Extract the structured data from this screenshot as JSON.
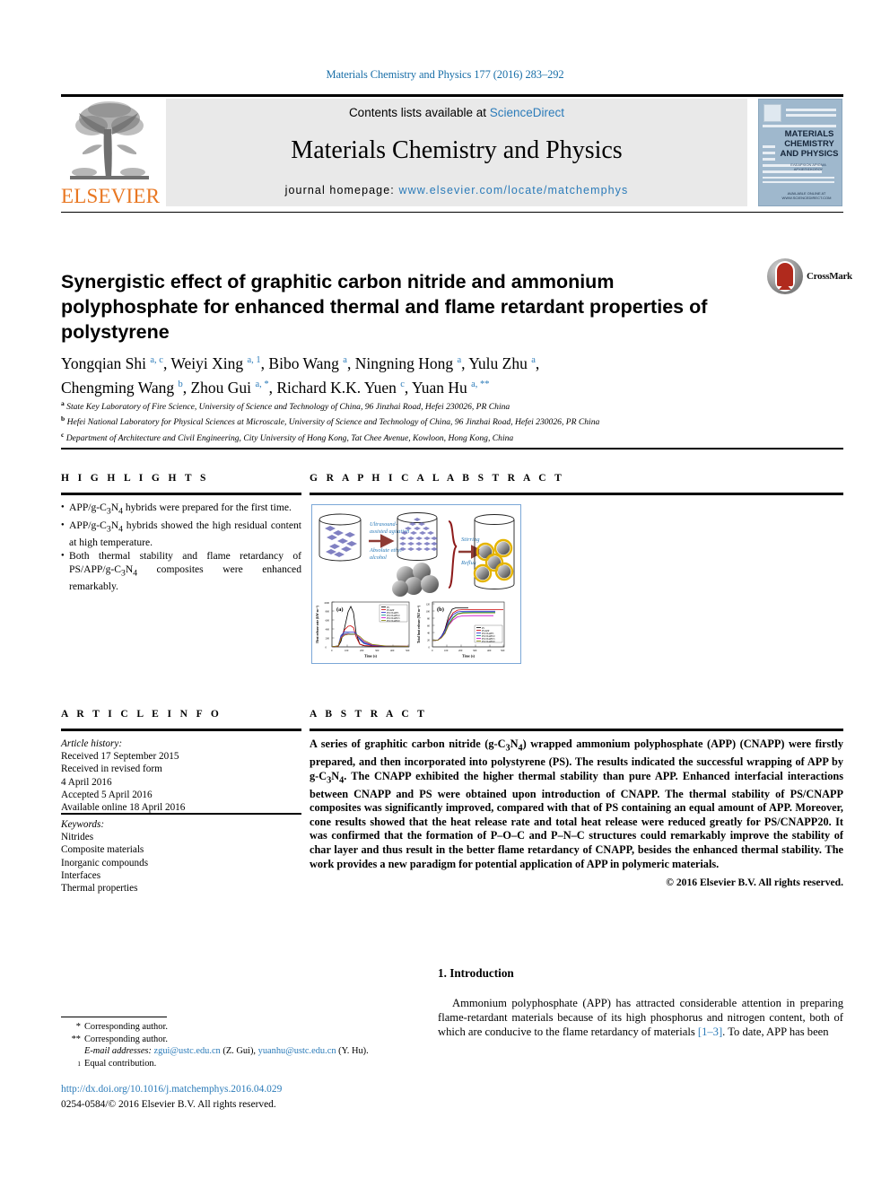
{
  "running_head": "Materials Chemistry and Physics 177 (2016) 283–292",
  "masthead": {
    "publisher_logo_text": "ELSEVIER",
    "contents_prefix": "Contents lists available at ",
    "contents_link": "ScienceDirect",
    "journal_title": "Materials Chemistry and Physics",
    "homepage_prefix": "journal homepage: ",
    "homepage_link": "www.elsevier.com/locate/matchemphys",
    "cover": {
      "title": "MATERIALS CHEMISTRY AND PHYSICS",
      "subtitle": "ΕΛΕΑΡΧΙΟΝ  ΑΡΙΘΜΑ ΑΡΧΙΕΠΙΣΚΟΠΟΥ",
      "footer": "AVAILABLE ONLINE AT WWW.SCIENCEDIRECT.COM"
    }
  },
  "article": {
    "title": "Synergistic effect of graphitic carbon nitride and ammonium polyphosphate for enhanced thermal and flame retardant properties of polystyrene",
    "crossmark_label": "CrossMark",
    "authors_line1": "Yongqian Shi <sup>a, c</sup>, Weiyi Xing <sup>a, 1</sup>, Bibo Wang <sup>a</sup>, Ningning Hong <sup>a</sup>, Yulu Zhu <sup>a</sup>,",
    "authors_line2": "Chengming Wang <sup>b</sup>, Zhou Gui <sup>a, *</sup>, Richard K.K. Yuen <sup>c</sup>, Yuan Hu <sup>a, **</sup>",
    "affiliations": [
      "<sup>a</sup> State Key Laboratory of Fire Science, University of Science and Technology of China, 96 Jinzhai Road, Hefei 230026, PR China",
      "<sup>b</sup> Hefei National Laboratory for Physical Sciences at Microscale, University of Science and Technology of China, 96 Jinzhai Road, Hefei 230026, PR China",
      "<sup>c</sup> Department of Architecture and Civil Engineering, City University of Hong Kong, Tat Chee Avenue, Kowloon, Hong Kong, China"
    ]
  },
  "highlights": {
    "heading": "H I G H L I G H T S",
    "items": [
      "APP/g-C<sub>3</sub>N<sub>4</sub> hybrids were prepared for the first time.",
      "APP/g-C<sub>3</sub>N<sub>4</sub> hybrids showed the high residual content at high temperature.",
      "Both thermal stability and flame retardancy of PS/APP/g-C<sub>3</sub>N<sub>4</sub> composites were enhanced remarkably."
    ]
  },
  "graphical_abstract": {
    "heading": "G R A P H I C A L  A B S T R A C T",
    "diagram_labels": {
      "step1": "Ultrasound-assisted agitation",
      "step2": "Absolute ethyl alcohol",
      "step3": "Stirring",
      "step4": "Reflux"
    },
    "panel_a_label": "(a)",
    "panel_b_label": "(b)"
  },
  "chart_data": [
    {
      "type": "line",
      "title": "(a)",
      "xlabel": "Time (s)",
      "ylabel": "Heat release rate (kW m⁻²)",
      "xlim": [
        0,
        500
      ],
      "ylim": [
        0,
        1000
      ],
      "xticks": [
        0,
        100,
        200,
        300,
        400,
        500
      ],
      "yticks": [
        0,
        200,
        400,
        600,
        800,
        1000
      ],
      "legend_position": "upper-right",
      "series": [
        {
          "name": "PS",
          "color": "#000000",
          "x": [
            0,
            40,
            60,
            90,
            120,
            140,
            160,
            180,
            200,
            240,
            300,
            400,
            500
          ],
          "values": [
            5,
            10,
            120,
            420,
            780,
            900,
            760,
            300,
            60,
            25,
            15,
            10,
            8
          ]
        },
        {
          "name": "PS/APP",
          "color": "#cc0000",
          "x": [
            0,
            40,
            60,
            90,
            120,
            140,
            160,
            180,
            200,
            240,
            300,
            400,
            500
          ],
          "values": [
            5,
            10,
            180,
            380,
            460,
            470,
            430,
            220,
            60,
            30,
            20,
            15,
            12
          ]
        },
        {
          "name": "PS/CNAPP5",
          "color": "#2222cc",
          "x": [
            0,
            40,
            60,
            90,
            120,
            140,
            160,
            180,
            200,
            240,
            300,
            400,
            500
          ],
          "values": [
            5,
            15,
            250,
            340,
            330,
            330,
            330,
            300,
            160,
            70,
            30,
            15,
            10
          ]
        },
        {
          "name": "PS/CNAPP10",
          "color": "#008b8b",
          "x": [
            0,
            40,
            60,
            90,
            120,
            140,
            160,
            180,
            200,
            240,
            300,
            400,
            500
          ],
          "values": [
            5,
            20,
            230,
            300,
            300,
            290,
            290,
            270,
            180,
            90,
            35,
            15,
            10
          ]
        },
        {
          "name": "PS/CNAPP15",
          "color": "#cc00cc",
          "x": [
            0,
            40,
            60,
            90,
            120,
            140,
            160,
            180,
            200,
            240,
            300,
            400,
            500
          ],
          "values": [
            5,
            20,
            210,
            280,
            290,
            280,
            280,
            270,
            200,
            110,
            40,
            18,
            10
          ]
        },
        {
          "name": "PS/CNAPP20",
          "color": "#808000",
          "x": [
            0,
            40,
            60,
            90,
            120,
            140,
            160,
            180,
            200,
            240,
            300,
            400,
            500
          ],
          "values": [
            5,
            20,
            190,
            260,
            280,
            280,
            280,
            280,
            230,
            140,
            55,
            20,
            12
          ]
        }
      ]
    },
    {
      "type": "line",
      "title": "(b)",
      "xlabel": "Time (s)",
      "ylabel": "Total heat release (MJ m⁻²)",
      "xlim": [
        0,
        500
      ],
      "ylim": [
        0,
        120
      ],
      "xticks": [
        0,
        100,
        200,
        300,
        400,
        500
      ],
      "yticks": [
        0,
        20,
        40,
        60,
        80,
        100,
        120
      ],
      "legend_position": "lower-right",
      "series": [
        {
          "name": "PS",
          "color": "#000000",
          "x": [
            0,
            40,
            80,
            120,
            160,
            200,
            250,
            300,
            400,
            500
          ],
          "values": [
            0,
            2,
            18,
            70,
            104,
            106,
            106,
            106,
            106,
            106
          ]
        },
        {
          "name": "PS/APP",
          "color": "#cc0000",
          "x": [
            0,
            40,
            80,
            120,
            160,
            200,
            250,
            300,
            400,
            500
          ],
          "values": [
            0,
            2,
            22,
            62,
            88,
            98,
            100,
            100,
            100,
            100
          ]
        },
        {
          "name": "PS/CNAPP5",
          "color": "#2222cc",
          "x": [
            0,
            40,
            80,
            120,
            160,
            200,
            250,
            300,
            400,
            500
          ],
          "values": [
            0,
            2,
            24,
            60,
            84,
            93,
            95,
            95,
            95,
            95
          ]
        },
        {
          "name": "PS/CNAPP10",
          "color": "#008b8b",
          "x": [
            0,
            40,
            80,
            120,
            160,
            200,
            250,
            300,
            400,
            500
          ],
          "values": [
            0,
            2,
            20,
            52,
            76,
            88,
            92,
            92,
            92,
            92
          ]
        },
        {
          "name": "PS/CNAPP15",
          "color": "#cc00cc",
          "x": [
            0,
            40,
            80,
            120,
            160,
            200,
            250,
            300,
            400,
            500
          ],
          "values": [
            0,
            2,
            18,
            48,
            70,
            80,
            83,
            83,
            83,
            83
          ]
        },
        {
          "name": "PS/CNAPP20",
          "color": "#808000",
          "x": [
            0,
            40,
            80,
            120,
            160,
            200,
            250,
            300,
            400,
            500
          ],
          "values": [
            0,
            2,
            16,
            46,
            72,
            85,
            90,
            90,
            90,
            90
          ]
        }
      ]
    }
  ],
  "article_info": {
    "heading": "A R T I C L E   I N F O",
    "history_label": "Article history:",
    "history": [
      "Received 17 September 2015",
      "Received in revised form",
      "4 April 2016",
      "Accepted 5 April 2016",
      "Available online 18 April 2016"
    ],
    "keywords_label": "Keywords:",
    "keywords": [
      "Nitrides",
      "Composite materials",
      "Inorganic compounds",
      "Interfaces",
      "Thermal properties"
    ]
  },
  "abstract": {
    "heading": "A B S T R A C T",
    "text": "A series of graphitic carbon nitride (g-C<sub>3</sub>N<sub>4</sub>) wrapped ammonium polyphosphate (APP) (CNAPP) were firstly prepared, and then incorporated into polystyrene (PS). The results indicated the successful wrapping of APP by g-C<sub>3</sub>N<sub>4</sub>. The CNAPP exhibited the higher thermal stability than pure APP. Enhanced interfacial interactions between CNAPP and PS were obtained upon introduction of CNAPP. The thermal stability of PS/CNAPP composites was significantly improved, compared with that of PS containing an equal amount of APP. Moreover, cone results showed that the heat release rate and total heat release were reduced greatly for PS/CNAPP20. It was confirmed that the formation of P–O–C and P–N–C structures could remarkably improve the stability of char layer and thus result in the better flame retardancy of CNAPP, besides the enhanced thermal stability. The work provides a new paradigm for potential application of APP in polymeric materials.",
    "copyright": "© 2016 Elsevier B.V. All rights reserved."
  },
  "introduction": {
    "heading": "1.  Introduction",
    "paragraph_pre": "Ammonium polyphosphate (APP) has attracted considerable attention in preparing flame-retardant materials because of its high phosphorus and nitrogen content, both of which are conducive to the flame retardancy of materials ",
    "reference": "[1–3]",
    "paragraph_post": ". To date, APP has been"
  },
  "footnotes": {
    "corresponding_1_mark": "*",
    "corresponding_1": "Corresponding author.",
    "corresponding_2_mark": "**",
    "corresponding_2": "Corresponding author.",
    "email_label": "E-mail addresses:",
    "email_1": "zgui@ustc.edu.cn",
    "email_1_name": "(Z. Gui)",
    "email_2": "yuanhu@ustc.edu.cn",
    "email_2_name": "(Y. Hu).",
    "equal_mark": "1",
    "equal_contribution": "Equal contribution.",
    "doi": "http://dx.doi.org/10.1016/j.matchemphys.2016.04.029",
    "issn": "0254-0584/© 2016 Elsevier B.V. All rights reserved."
  },
  "colors": {
    "link": "#2b7bb9",
    "elsevier_orange": "#E87722",
    "band_gray": "#e9e9e9",
    "crossmark_red": "#b02a1d",
    "figure_border": "#7ba7d7"
  }
}
